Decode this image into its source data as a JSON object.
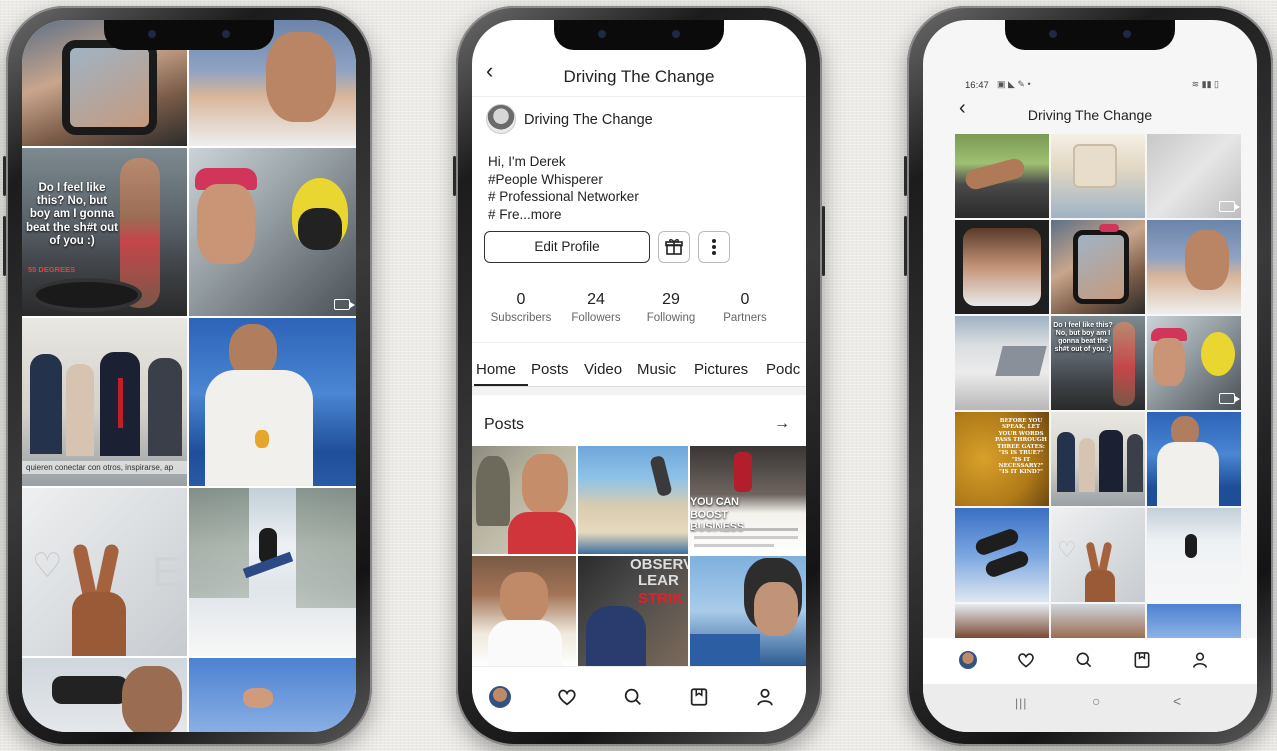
{
  "left_phone": {
    "captions": {
      "fitness_quote": "Do I feel like this? No, but boy am I gonna beat the sh#t out of you :)",
      "fitness_brand": "55 DEGREES",
      "overlay_text": "quieren conectar con otros, inspirarse, ap"
    }
  },
  "middle_phone": {
    "header_title": "Driving The Change",
    "back_icon": "chevron-left-icon",
    "profile_name": "Driving The Change",
    "bio": {
      "line1": "Hi, I'm Derek",
      "line2": "#People Whisperer",
      "line3": "# Professional Networker",
      "line4": "# Fre...more"
    },
    "edit_profile_label": "Edit Profile",
    "stats": [
      {
        "value": "0",
        "label": "Subscribers"
      },
      {
        "value": "24",
        "label": "Followers"
      },
      {
        "value": "29",
        "label": "Following"
      },
      {
        "value": "0",
        "label": "Partners"
      }
    ],
    "tabs": [
      "Home",
      "Posts",
      "Video",
      "Music",
      "Pictures",
      "Podc"
    ],
    "active_tab": "Home",
    "posts_section_title": "Posts",
    "posts_arrow": "→",
    "tile_texts": {
      "boost": "YOU CAN BOOST BUSINESS",
      "observe": "OBSERV",
      "learn": "LEAR",
      "strike": "STRIK"
    },
    "bottom_nav": [
      "avatar",
      "heart-icon",
      "search-icon",
      "bookmark-icon",
      "profile-icon"
    ]
  },
  "right_phone": {
    "status_time": "16:47",
    "header_title": "Driving The Change",
    "buddha_quote": "BEFORE YOU SPEAK, LET YOUR WORDS PASS THROUGH THREE GATES: \"IS IS TRUE?\" \"IS IT NECESSARY?\" \"IS IT KIND?\"",
    "fitness_quote_small": "Do I feel like this? No, but boy am I gonna beat the sh#t out of you :)",
    "android_nav": {
      "recent": "|||",
      "home": "○",
      "back": "<"
    }
  },
  "colors": {
    "accent": "#222222",
    "background": "#eceae6",
    "phone_frame": "#1c1c1c"
  }
}
